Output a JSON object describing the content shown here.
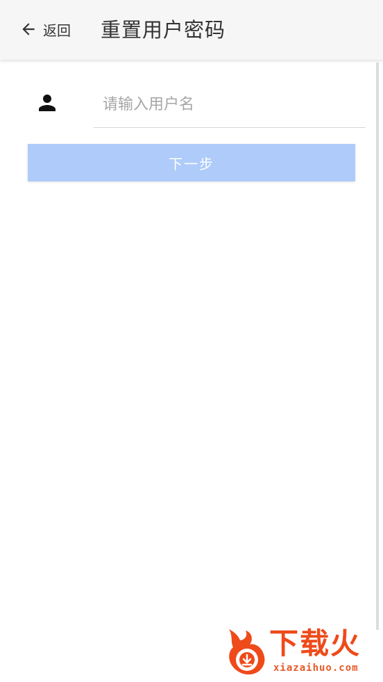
{
  "header": {
    "back_label": "返回",
    "title": "重置用户密码"
  },
  "form": {
    "username_placeholder": "请输入用户名",
    "username_value": "",
    "next_label": "下一步"
  },
  "colors": {
    "header_bg": "#f6f6f6",
    "button_bg": "#aecbfa",
    "button_text": "#ffffff",
    "watermark": "#ee4a1a"
  },
  "icons": {
    "back": "arrow-left-icon",
    "user": "user-icon"
  },
  "watermark": {
    "brand": "下载火",
    "url": "xiazaihuo.com"
  }
}
